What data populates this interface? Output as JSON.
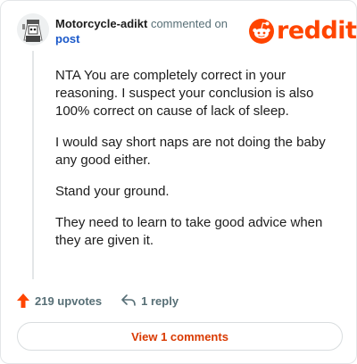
{
  "comment": {
    "username": "Motorcycle-adikt",
    "action_text": "commented on",
    "post_link_label": "post",
    "paragraphs": [
      "NTA You are completely correct in your reasoning. I suspect your conclusion is also 100% correct on cause of lack of sleep.",
      "I would say short naps are not doing the baby any good either.",
      "Stand your ground.",
      "They need to learn to take good advice when they are given it."
    ],
    "upvotes_label": "219 upvotes",
    "replies_label": "1 reply"
  },
  "brand": {
    "name": "reddit",
    "logo_icon": "reddit-snoo-icon",
    "color": "#ff4500"
  },
  "view_button_label": "View 1 comments",
  "colors": {
    "upvote": "#ff4500",
    "link": "#1a58c9",
    "view_button_text": "#d93900"
  }
}
